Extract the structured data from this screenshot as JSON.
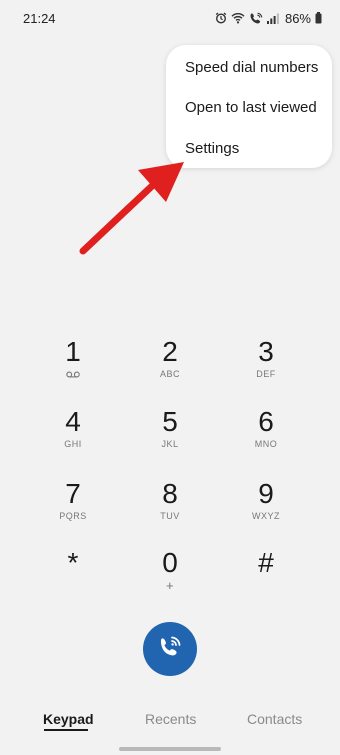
{
  "status_bar": {
    "time": "21:24",
    "battery": "86%",
    "icons": [
      "alarm-icon",
      "wifi-icon",
      "wifi-calling-icon",
      "signal-icon",
      "battery-icon"
    ]
  },
  "menu": {
    "items": [
      {
        "label": "Speed dial numbers"
      },
      {
        "label": "Open to last viewed"
      },
      {
        "label": "Settings"
      }
    ]
  },
  "keypad": {
    "keys": [
      {
        "digit": "1",
        "letters": "",
        "icon": "voicemail-icon"
      },
      {
        "digit": "2",
        "letters": "ABC"
      },
      {
        "digit": "3",
        "letters": "DEF"
      },
      {
        "digit": "4",
        "letters": "GHI"
      },
      {
        "digit": "5",
        "letters": "JKL"
      },
      {
        "digit": "6",
        "letters": "MNO"
      },
      {
        "digit": "7",
        "letters": "PQRS"
      },
      {
        "digit": "8",
        "letters": "TUV"
      },
      {
        "digit": "9",
        "letters": "WXYZ"
      },
      {
        "digit": "*",
        "letters": ""
      },
      {
        "digit": "0",
        "letters": "+"
      },
      {
        "digit": "#",
        "letters": ""
      }
    ]
  },
  "call_button": {
    "icon": "wifi-call-icon",
    "color": "#2164b0"
  },
  "tabs": [
    {
      "label": "Keypad",
      "active": true
    },
    {
      "label": "Recents"
    },
    {
      "label": "Contacts"
    }
  ],
  "annotation": {
    "arrow_color": "#e0201f"
  }
}
